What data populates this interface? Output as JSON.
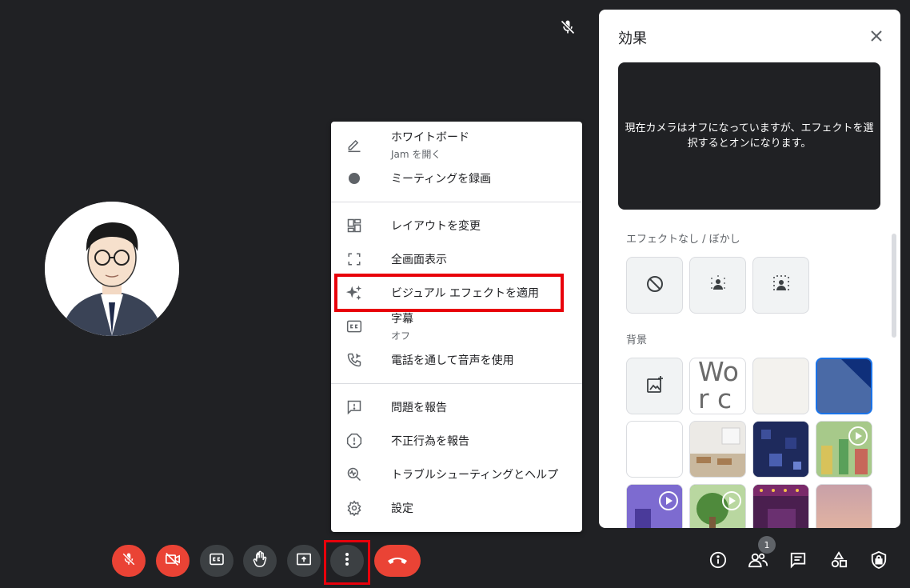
{
  "menu": {
    "items": [
      {
        "label": "ホワイトボード",
        "sub": "Jam を開く",
        "icon": "pencil-icon"
      },
      {
        "label": "ミーティングを録画",
        "icon": "record-icon"
      },
      {
        "label": "レイアウトを変更",
        "icon": "layout-icon"
      },
      {
        "label": "全画面表示",
        "icon": "fullscreen-icon"
      },
      {
        "label": "ビジュアル エフェクトを適用",
        "icon": "sparkle-icon"
      },
      {
        "label": "字幕",
        "sub": "オフ",
        "icon": "captions-icon"
      },
      {
        "label": "電話を通して音声を使用",
        "icon": "phone-icon"
      },
      {
        "label": "問題を報告",
        "icon": "feedback-icon"
      },
      {
        "label": "不正行為を報告",
        "icon": "report-icon"
      },
      {
        "label": "トラブルシューティングとヘルプ",
        "icon": "troubleshoot-icon"
      },
      {
        "label": "設定",
        "icon": "gear-icon"
      }
    ]
  },
  "effects_panel": {
    "title": "効果",
    "preview_text": "現在カメラはオフになっていますが、エフェクトを選択するとオンになります。",
    "section_blur": "エフェクトなし / ぼかし",
    "section_background": "背景",
    "tile_text": "Wor catio"
  },
  "toolbar": {
    "participants_count": "1"
  },
  "colors": {
    "background": "#202124",
    "accent_red": "#ea4335",
    "highlight": "#e8000b",
    "selected_blue": "#1a73e8"
  }
}
